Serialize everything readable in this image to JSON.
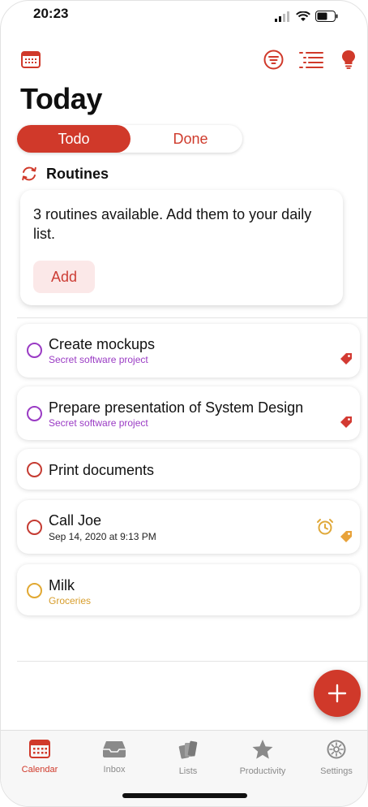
{
  "status_bar": {
    "time": "20:23"
  },
  "toolbar": {
    "calendar_icon": "calendar-icon",
    "filter_icon": "filter-icon",
    "list_icon": "list-icon",
    "idea_icon": "lightbulb-icon"
  },
  "page": {
    "title": "Today"
  },
  "segmented": {
    "todo": "Todo",
    "done": "Done",
    "selected": "Todo"
  },
  "routines": {
    "heading": "Routines",
    "message": "3 routines available. Add them to your daily list.",
    "add_label": "Add"
  },
  "tasks": [
    {
      "title": "Create mockups",
      "subtitle": "Secret software project",
      "subtitle_color": "#9a3bc4",
      "circle_color": "#9a3bc4",
      "tag_color": "#d33a32"
    },
    {
      "title": "Prepare presentation of System Design",
      "subtitle": "Secret software project",
      "subtitle_color": "#9a3bc4",
      "circle_color": "#9a3bc4",
      "tag_color": "#d33a32"
    },
    {
      "title": "Print documents",
      "subtitle": "",
      "circle_color": "#c53b32"
    },
    {
      "title": "Call Joe",
      "subtitle": "Sep 14, 2020 at 9:13 PM",
      "subtitle_color": "#222222",
      "circle_color": "#c53b32",
      "alarm_color": "#e0a93a",
      "tag_color": "#e8a23a"
    },
    {
      "title": "Milk",
      "subtitle": "Groceries",
      "subtitle_color": "#d79d2b",
      "circle_color": "#e1a832"
    }
  ],
  "tabbar": {
    "items": [
      {
        "label": "Calendar",
        "icon": "calendar-icon",
        "active": true
      },
      {
        "label": "Inbox",
        "icon": "inbox-icon",
        "active": false
      },
      {
        "label": "Lists",
        "icon": "lists-icon",
        "active": false
      },
      {
        "label": "Productivity",
        "icon": "star-icon",
        "active": false
      },
      {
        "label": "Settings",
        "icon": "gear-icon",
        "active": false
      }
    ]
  },
  "colors": {
    "accent": "#d0392a",
    "purple": "#9a3bc4",
    "orange": "#e1a832"
  }
}
